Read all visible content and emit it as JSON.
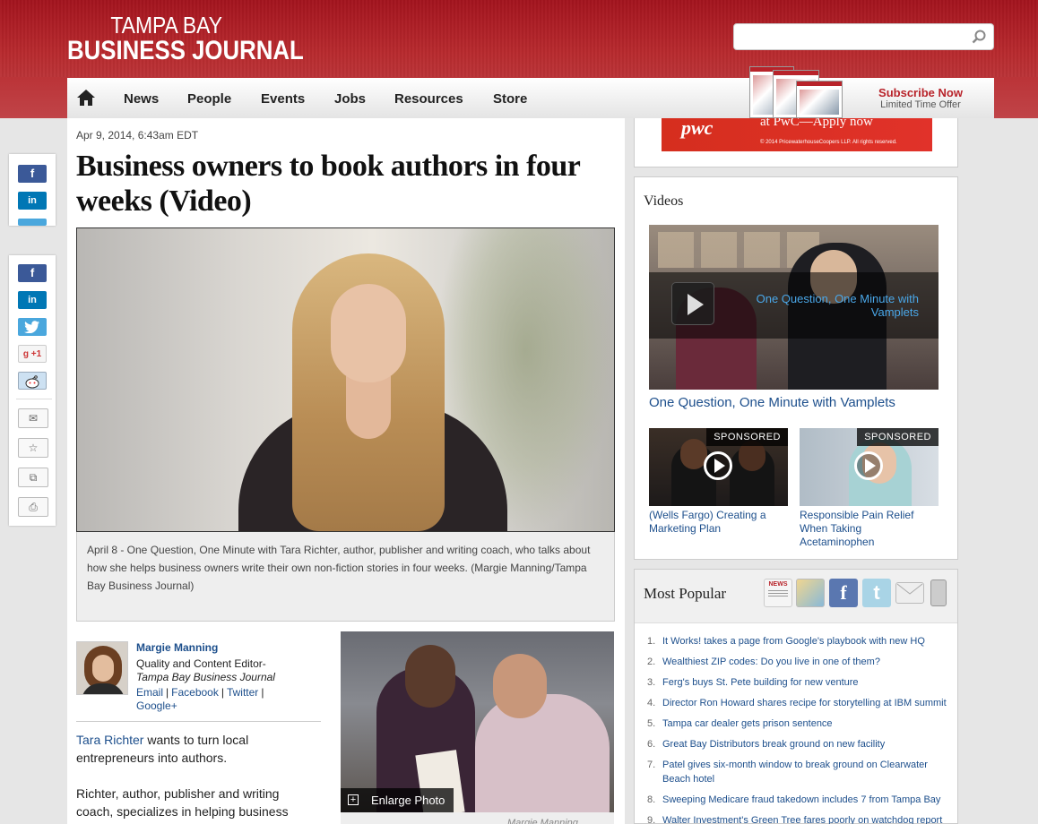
{
  "header": {
    "logo_line1": "TAMPA BAY",
    "logo_line2": "BUSINESS JOURNAL",
    "search_placeholder": "",
    "brand_color": "#b8232a"
  },
  "nav": {
    "items": [
      "News",
      "People",
      "Events",
      "Jobs",
      "Resources",
      "Store"
    ],
    "subscribe": "Subscribe Now",
    "subscribe_sub": "Limited Time Offer"
  },
  "ad": {
    "brand": "pwc",
    "text": "at PwC—Apply now",
    "copyright": "© 2014 PricewaterhouseCoopers LLP. All rights reserved."
  },
  "share": {
    "tools": [
      "mail-icon",
      "star-icon",
      "copy-icon",
      "print-icon"
    ]
  },
  "article": {
    "date": "Apr 9, 2014, 6:43am EDT",
    "headline": "Business owners to book authors in four weeks (Video)",
    "caption": "April 8 - One Question, One Minute with Tara Richter, author, publisher and writing coach, who talks about how she helps business owners write their own non-fiction stories in four weeks. (Margie Manning/Tampa Bay Business Journal)",
    "author": {
      "name": "Margie Manning",
      "role": "Quality and Content Editor-",
      "publication": "Tampa Bay Business Journal",
      "links": [
        "Email",
        "Facebook",
        "Twitter",
        "Google+"
      ]
    },
    "body": {
      "p1_link": "Tara Richter",
      "p1_rest": " wants to turn local entrepreneurs into authors.",
      "p2": "Richter, author, publisher and writing coach, specializes in helping business"
    },
    "photo_enlarge": "Enlarge Photo",
    "photo_credit": "Margie Manning"
  },
  "videos": {
    "title": "Videos",
    "main_title": "One Question, One Minute with Vamplets",
    "main_link": "One Question, One Minute with Vamplets",
    "sponsored": [
      {
        "badge": "SPONSORED",
        "caption": "(Wells Fargo) Creating a Marketing Plan"
      },
      {
        "badge": "SPONSORED",
        "caption": "Responsible Pain Relief When Taking Acetaminophen"
      }
    ]
  },
  "popular": {
    "title": "Most Popular",
    "tab_news": "NEWS",
    "items": [
      {
        "num": "1.",
        "text": "It Works! takes a page from Google's playbook with new HQ"
      },
      {
        "num": "2.",
        "text": "Wealthiest ZIP codes: Do you live in one of them?"
      },
      {
        "num": "3.",
        "text": "Ferg's buys St. Pete building for new venture"
      },
      {
        "num": "4.",
        "text": "Director Ron Howard shares recipe for storytelling at IBM summit"
      },
      {
        "num": "5.",
        "text": "Tampa car dealer gets prison sentence"
      },
      {
        "num": "6.",
        "text": "Great Bay Distributors break ground on new facility"
      },
      {
        "num": "7.",
        "text": "Patel gives six-month window to break ground on Clearwater Beach hotel"
      },
      {
        "num": "8.",
        "text": "Sweeping Medicare fraud takedown includes 7 from Tampa Bay"
      },
      {
        "num": "9.",
        "text": "Walter Investment's Green Tree fares poorly on watchdog report"
      }
    ]
  }
}
